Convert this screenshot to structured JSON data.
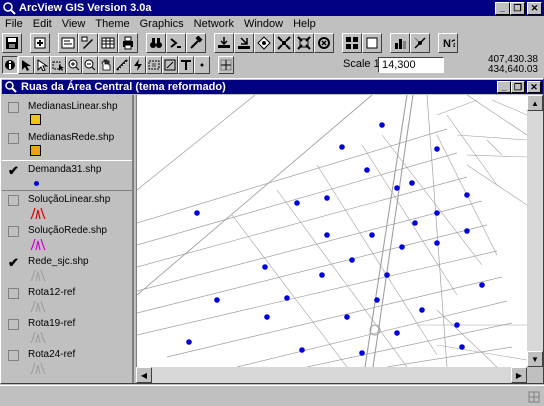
{
  "app": {
    "title": "ArcView GIS Version 3.0a"
  },
  "menu": [
    "File",
    "Edit",
    "View",
    "Theme",
    "Graphics",
    "Network",
    "Window",
    "Help"
  ],
  "toolbar": {
    "scale_label": "Scale 1:",
    "scale_value": "14,300",
    "coord_x": "407,430.38",
    "coord_y": "434,640.03"
  },
  "view": {
    "title": "Ruas da Área Central (tema reformado)"
  },
  "themes": [
    {
      "name": "MedianasLinear.shp",
      "checked": false,
      "symbol": "box",
      "color": "#f0c800"
    },
    {
      "name": "MedianasRede.shp",
      "checked": false,
      "symbol": "box",
      "color": "#e8a800"
    },
    {
      "name": "Demanda31.shp",
      "checked": true,
      "active": true,
      "symbol": "dot",
      "color": "#0000e0"
    },
    {
      "name": "SoluçãoLinear.shp",
      "checked": false,
      "symbol": "line",
      "color": "#e00000"
    },
    {
      "name": "SoluçãoRede.shp",
      "checked": false,
      "symbol": "line",
      "color": "#d000d0"
    },
    {
      "name": "Rede_sjc.shp",
      "checked": true,
      "symbol": "line",
      "color": "#a0a0a0"
    },
    {
      "name": "Rota12-ref",
      "checked": false,
      "symbol": "line",
      "color": "#a0a0a0"
    },
    {
      "name": "Rota19-ref",
      "checked": false,
      "symbol": "line",
      "color": "#a0a0a0"
    },
    {
      "name": "Rota24-ref",
      "checked": false,
      "symbol": "line",
      "color": "#a0a0a0"
    }
  ],
  "icons": {
    "title": "globe-icon",
    "view_title": "view-globe-icon"
  },
  "colors": {
    "titlebar": "#000080",
    "demand_points": "#0000e0",
    "streets": "#a0a0a0"
  }
}
